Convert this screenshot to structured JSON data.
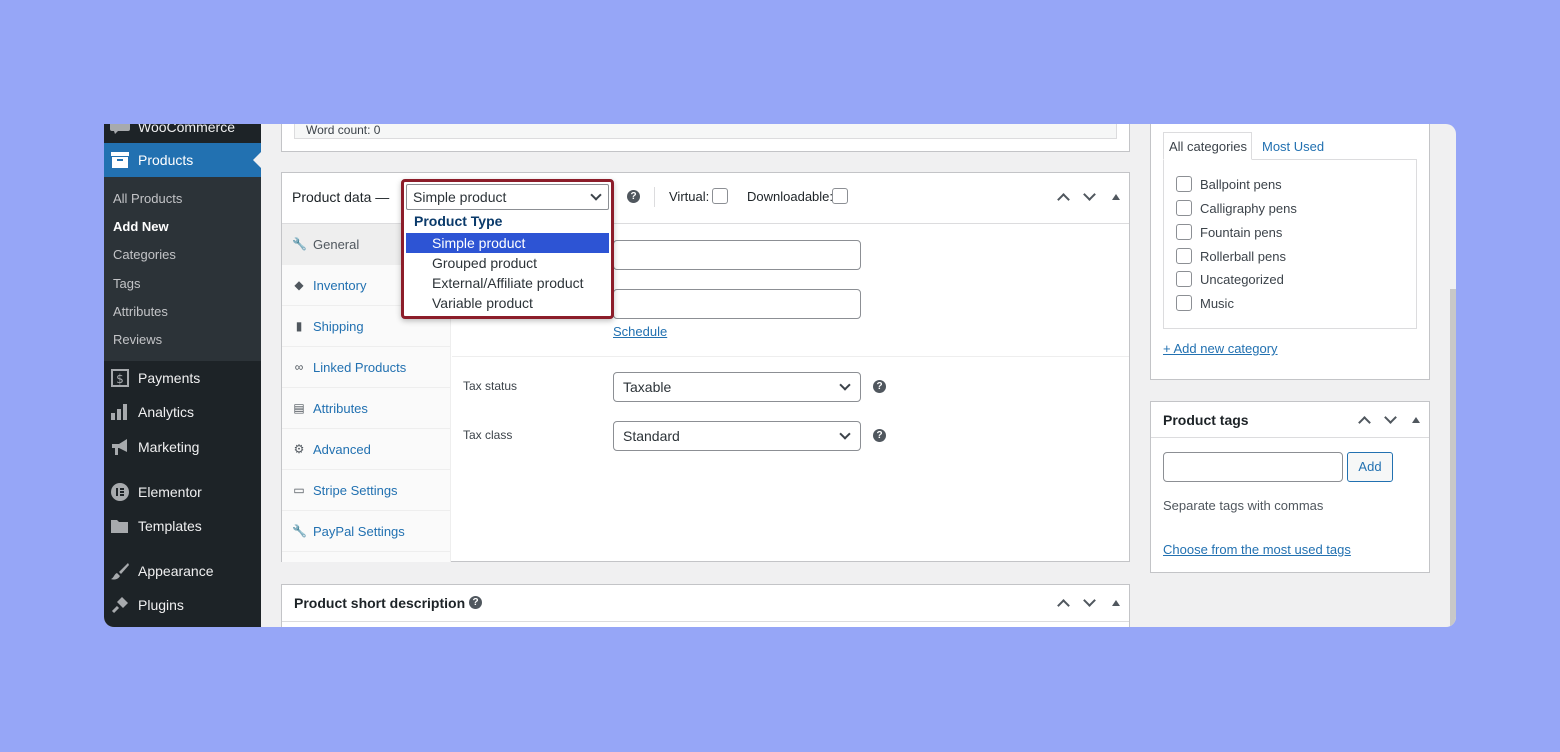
{
  "sidebar": {
    "items": [
      {
        "label": "WooCommerce",
        "icon": "woo-icon"
      },
      {
        "label": "Products",
        "icon": "archive-icon"
      },
      {
        "label": "Payments",
        "icon": "dollar-icon"
      },
      {
        "label": "Analytics",
        "icon": "bar-chart-icon"
      },
      {
        "label": "Marketing",
        "icon": "megaphone-icon"
      },
      {
        "label": "Elementor",
        "icon": "elementor-icon"
      },
      {
        "label": "Templates",
        "icon": "folder-icon"
      },
      {
        "label": "Appearance",
        "icon": "paintbrush-icon"
      },
      {
        "label": "Plugins",
        "icon": "plug-icon"
      }
    ],
    "submenu": [
      "All Products",
      "Add New",
      "Categories",
      "Tags",
      "Attributes",
      "Reviews"
    ]
  },
  "editor": {
    "word_count": "Word count: 0"
  },
  "product_data": {
    "title": "Product data —",
    "selected_type": "Simple product",
    "option_group": "Product Type",
    "options": [
      "Simple product",
      "Grouped product",
      "External/Affiliate product",
      "Variable product"
    ],
    "virtual_label": "Virtual:",
    "downloadable_label": "Downloadable:",
    "tabs": [
      "General",
      "Inventory",
      "Shipping",
      "Linked Products",
      "Attributes",
      "Advanced",
      "Stripe Settings",
      "PayPal Settings"
    ],
    "schedule_link": "Schedule",
    "tax_status_label": "Tax status",
    "tax_status_value": "Taxable",
    "tax_class_label": "Tax class",
    "tax_class_value": "Standard"
  },
  "short_description": {
    "title": "Product short description"
  },
  "categories": {
    "tab_all": "All categories",
    "tab_most_used": "Most Used",
    "items": [
      "Ballpoint pens",
      "Calligraphy pens",
      "Fountain pens",
      "Rollerball pens",
      "Uncategorized",
      "Music"
    ],
    "add_link": "+ Add new category"
  },
  "tags": {
    "title": "Product tags",
    "add_button": "Add",
    "hint": "Separate tags with commas",
    "choose_link": "Choose from the most used tags"
  },
  "colors": {
    "accent": "#2271b1",
    "sidebar": "#1d2327",
    "background": "#96a6f7",
    "highlight": "#8c1d2a"
  }
}
